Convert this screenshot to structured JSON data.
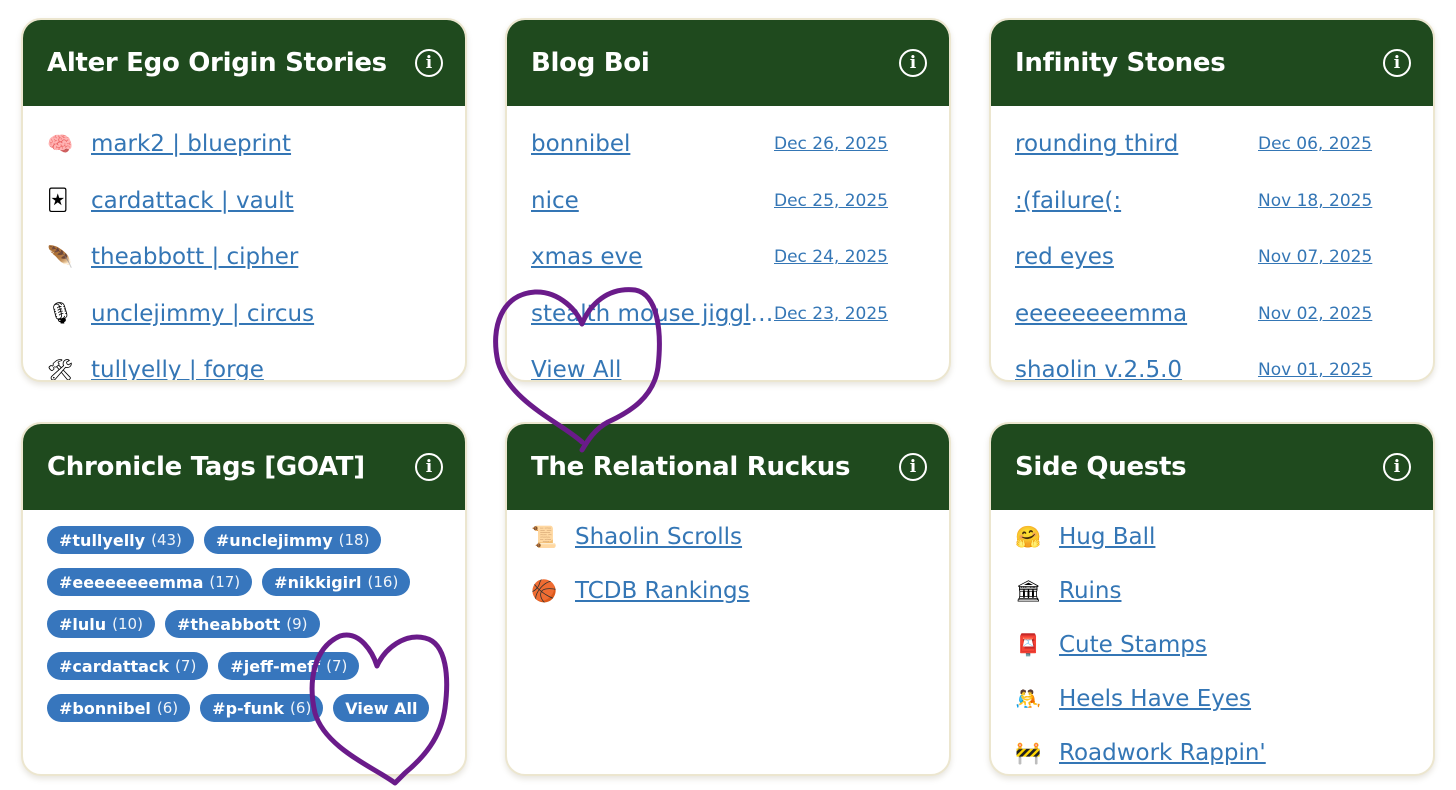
{
  "colors": {
    "header_bg": "#1f4a1e",
    "link": "#3476b5",
    "tag_bg": "#3776bd",
    "doodle": "#6a1b8a"
  },
  "alter_ego": {
    "title": "Alter Ego Origin Stories",
    "items": [
      {
        "icon": "brain-icon",
        "glyph": "🧠",
        "label": "mark2 | blueprint"
      },
      {
        "icon": "cards-icon",
        "glyph": "🃏",
        "label": "cardattack | vault"
      },
      {
        "icon": "feather-icon",
        "glyph": "🪶",
        "label": "theabbott | cipher"
      },
      {
        "icon": "microphone-icon",
        "glyph": "🎙",
        "label": "unclejimmy | circus"
      },
      {
        "icon": "tools-icon",
        "glyph": "🛠",
        "label": "tullyelly | forge"
      }
    ]
  },
  "blog": {
    "title": "Blog Boi",
    "items": [
      {
        "label": "bonnibel",
        "date": "Dec 26, 2025"
      },
      {
        "label": "nice",
        "date": "Dec 25, 2025"
      },
      {
        "label": "xmas eve",
        "date": "Dec 24, 2025"
      },
      {
        "label": "stealth mouse jiggler",
        "date": "Dec 23, 2025"
      }
    ],
    "view_all": "View All"
  },
  "infinity": {
    "title": "Infinity Stones",
    "items": [
      {
        "label": "rounding third",
        "date": "Dec 06, 2025"
      },
      {
        "label": ":(failure(:",
        "date": "Nov 18, 2025"
      },
      {
        "label": "red eyes",
        "date": "Nov 07, 2025"
      },
      {
        "label": "eeeeeeeemma",
        "date": "Nov 02, 2025"
      },
      {
        "label": "shaolin v.2.5.0",
        "date": "Nov 01, 2025"
      }
    ]
  },
  "tags": {
    "title": "Chronicle Tags [GOAT]",
    "items": [
      {
        "name": "#tullyelly",
        "count": "(43)"
      },
      {
        "name": "#unclejimmy",
        "count": "(18)"
      },
      {
        "name": "#eeeeeeeemma",
        "count": "(17)"
      },
      {
        "name": "#nikkigirl",
        "count": "(16)"
      },
      {
        "name": "#lulu",
        "count": "(10)"
      },
      {
        "name": "#theabbott",
        "count": "(9)"
      },
      {
        "name": "#cardattack",
        "count": "(7)"
      },
      {
        "name": "#jeff-meff",
        "count": "(7)"
      },
      {
        "name": "#bonnibel",
        "count": "(6)"
      },
      {
        "name": "#p-funk",
        "count": "(6)"
      }
    ],
    "view_all": "View All"
  },
  "relational": {
    "title": "The Relational Ruckus",
    "items": [
      {
        "icon": "scroll-icon",
        "glyph": "📜",
        "label": "Shaolin Scrolls"
      },
      {
        "icon": "basketball-icon",
        "glyph": "🏀",
        "label": "TCDB Rankings"
      }
    ]
  },
  "side_quests": {
    "title": "Side Quests",
    "items": [
      {
        "icon": "hugging-face-icon",
        "glyph": "🤗",
        "label": "Hug Ball"
      },
      {
        "icon": "ruins-icon",
        "glyph": "🏛",
        "label": "Ruins"
      },
      {
        "icon": "postbox-icon",
        "glyph": "📮",
        "label": "Cute Stamps"
      },
      {
        "icon": "wrestlers-icon",
        "glyph": "🤼",
        "label": "Heels Have Eyes"
      },
      {
        "icon": "construction-icon",
        "glyph": "🚧",
        "label": "Roadwork Rappin'"
      }
    ]
  }
}
